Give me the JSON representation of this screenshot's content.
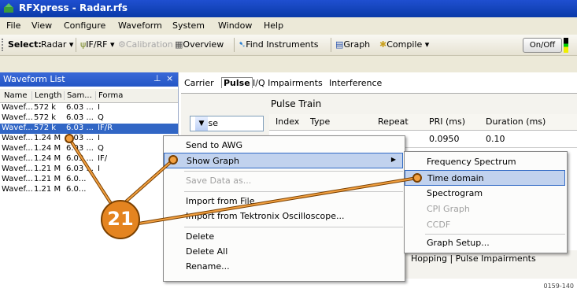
{
  "window": {
    "title": "RFXpress - Radar.rfs"
  },
  "menubar": [
    "File",
    "View",
    "Configure",
    "Waveform",
    "System",
    "Window",
    "Help"
  ],
  "toolbar": {
    "select_label": "Select:",
    "select_value": "Radar",
    "ifrf": "IF/RF",
    "calibration": "Calibration",
    "overview": "Overview",
    "find_instruments": "Find Instruments",
    "graph": "Graph",
    "compile": "Compile",
    "onoff": "On/Off"
  },
  "waveform_list": {
    "title": "Waveform List",
    "pin": "←",
    "close": "×",
    "columns": [
      "Name",
      "Length",
      "Sam...",
      "Forma"
    ],
    "rows": [
      [
        "Wavef...",
        "572 k",
        "6.03 ...",
        "I"
      ],
      [
        "Wavef...",
        "572 k",
        "6.03 ...",
        "Q"
      ],
      [
        "Wavef...",
        "572 k",
        "6.03 ...",
        "IF/R"
      ],
      [
        "Wavef...",
        "1.24 M",
        "6.03 ...",
        "I"
      ],
      [
        "Wavef...",
        "1.24 M",
        "6.03 ...",
        "Q"
      ],
      [
        "Wavef...",
        "1.24 M",
        "6.03 ...",
        "IF/"
      ],
      [
        "Wavef...",
        "1.21 M",
        "6.03 ...",
        "I"
      ],
      [
        "Wavef...",
        "1.21 M",
        "6.0...",
        ""
      ],
      [
        "Wavef...",
        "1.21 M",
        "6.0...",
        ""
      ]
    ],
    "selected_row_index": 2
  },
  "tabs": [
    "Carrier",
    "Pulse",
    "I/Q Impairments",
    "Interference"
  ],
  "active_tab": "Pulse",
  "pulse": {
    "section_title": "Pulse Train",
    "combo_value": "Pulse",
    "columns": [
      "Index",
      "Type",
      "Repeat",
      "PRI (ms)",
      "Duration (ms)"
    ],
    "first_row": {
      "pri": "0.0950",
      "duration": "0.10"
    },
    "bottom_tabs": "Hopping | Pulse Impairments"
  },
  "context_menu": {
    "items": [
      {
        "label": "Send to AWG",
        "enabled": true
      },
      {
        "label": "Show Graph",
        "enabled": true,
        "submenu": true,
        "highlighted": true
      },
      {
        "label": "Save Data as...",
        "enabled": false
      },
      {
        "label": "Import from File...",
        "enabled": true
      },
      {
        "label": "Import from Tektronix Oscilloscope...",
        "enabled": true
      },
      {
        "label": "Delete",
        "enabled": true
      },
      {
        "label": "Delete All",
        "enabled": true
      },
      {
        "label": "Rename...",
        "enabled": true
      }
    ]
  },
  "submenu": {
    "items": [
      {
        "label": "Frequency Spectrum",
        "enabled": true
      },
      {
        "label": "Time domain",
        "enabled": true,
        "highlighted": true
      },
      {
        "label": "Spectrogram",
        "enabled": true
      },
      {
        "label": "CPI Graph",
        "enabled": false
      },
      {
        "label": "CCDF",
        "enabled": false
      },
      {
        "label": "Graph Setup...",
        "enabled": true
      }
    ]
  },
  "callout": {
    "number": "21"
  },
  "figure_id": "0159-140",
  "colors": {
    "title_bar": "#1f4fd0",
    "selection": "#3166c5",
    "menu_highlight": "#c1d2ee",
    "callout": "#e48420"
  }
}
